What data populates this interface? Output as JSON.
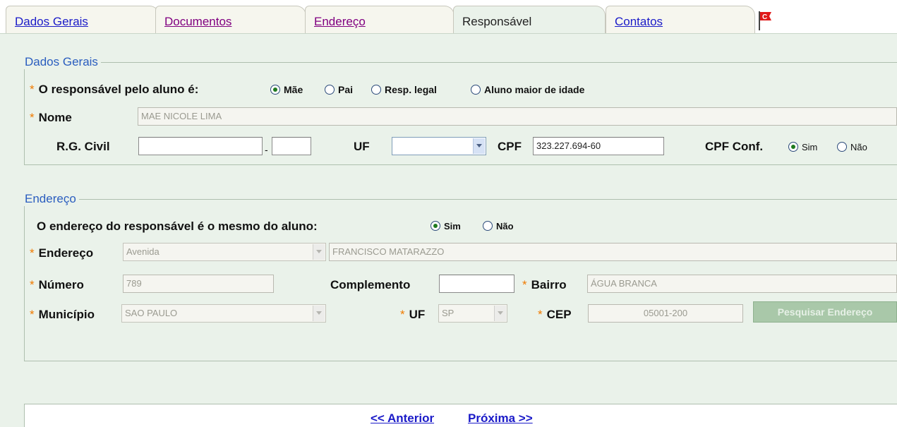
{
  "tabs": [
    {
      "label": "Dados Gerais"
    },
    {
      "label": "Documentos"
    },
    {
      "label": "Endereço"
    },
    {
      "label": "Responsável"
    },
    {
      "label": "Contatos"
    }
  ],
  "flag_letter": "C",
  "dados_gerais": {
    "legend": "Dados Gerais",
    "responsavel_label": "O responsável pelo aluno é:",
    "responsavel_options": [
      "Mãe",
      "Pai",
      "Resp. legal",
      "Aluno maior de idade"
    ],
    "responsavel_selected": "Mãe",
    "nome_label": "Nome",
    "nome_value": "MAE NICOLE LIMA",
    "rg_label": "R.G. Civil",
    "rg_value": "",
    "rg_digit_value": "",
    "rg_separator": "-",
    "uf_label": "UF",
    "uf_value": "",
    "cpf_label": "CPF",
    "cpf_value": "323.227.694-60",
    "cpf_conf_label": "CPF Conf.",
    "cpf_conf_options": [
      "Sim",
      "Não"
    ],
    "cpf_conf_selected": "Sim"
  },
  "endereco": {
    "legend": "Endereço",
    "mesmo_label": "O endereço do responsável é o mesmo do aluno:",
    "mesmo_options": [
      "Sim",
      "Não"
    ],
    "mesmo_selected": "Sim",
    "endereco_label": "Endereço",
    "tipo_logradouro": "Avenida",
    "logradouro": "FRANCISCO MATARAZZO",
    "numero_label": "Número",
    "numero_value": "789",
    "complemento_label": "Complemento",
    "complemento_value": "",
    "bairro_label": "Bairro",
    "bairro_value": "ÁGUA BRANCA",
    "municipio_label": "Município",
    "municipio_value": "SAO PAULO",
    "uf_label": "UF",
    "uf_value": "SP",
    "cep_label": "CEP",
    "cep_value": "05001-200",
    "search_button": "Pesquisar Endereço"
  },
  "navigation": {
    "previous": "<< Anterior",
    "next": "Próxima >>"
  },
  "colors": {
    "panel_bg": "#eaf2ea",
    "link": "#1a1ac8",
    "legend": "#2a5dbf",
    "required": "#f07a00"
  }
}
